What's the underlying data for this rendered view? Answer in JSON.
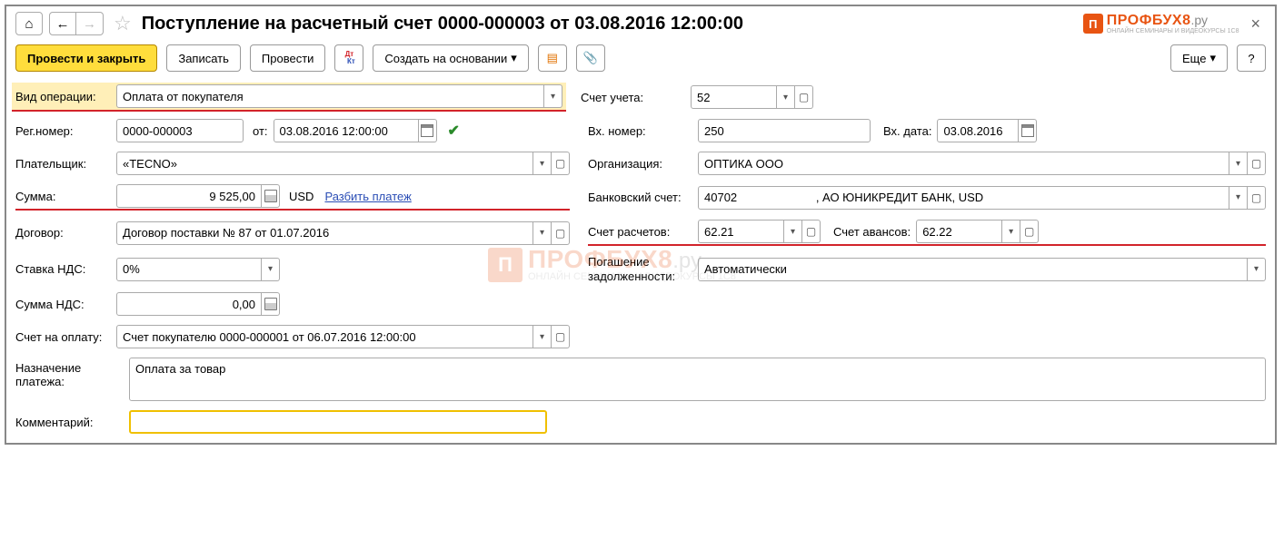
{
  "title": "Поступление на расчетный счет 0000-000003 от 03.08.2016 12:00:00",
  "toolbar": {
    "post_close": "Провести и закрыть",
    "save": "Записать",
    "post": "Провести",
    "create_based": "Создать на основании",
    "more": "Еще",
    "help": "?"
  },
  "logo": {
    "main": "ПРОФБУХ8",
    "ru": ".ру",
    "sub": "ОНЛАЙН СЕМИНАРЫ И ВИДЕОКУРСЫ 1С8"
  },
  "labels": {
    "operation_type": "Вид операции:",
    "account": "Счет учета:",
    "reg_no": "Рег.номер:",
    "from": "от:",
    "in_no": "Вх. номер:",
    "in_date": "Вх. дата:",
    "payer": "Плательщик:",
    "org": "Организация:",
    "sum": "Сумма:",
    "currency": "USD",
    "split": "Разбить платеж",
    "bank_acc": "Банковский счет:",
    "contract": "Договор:",
    "settle_acc": "Счет расчетов:",
    "advance_acc": "Счет авансов:",
    "vat_rate": "Ставка НДС:",
    "debt": "Погашение задолженности:",
    "vat_sum": "Сумма НДС:",
    "invoice": "Счет на оплату:",
    "purpose": "Назначение платежа:",
    "comment": "Комментарий:"
  },
  "values": {
    "operation_type": "Оплата от покупателя",
    "account": "52",
    "reg_no": "0000-000003",
    "reg_date": "03.08.2016 12:00:00",
    "in_no": "250",
    "in_date": "03.08.2016",
    "payer": "«TECNO»",
    "org": "ОПТИКА ООО",
    "sum": "9 525,00",
    "bank_acc": "40702                        , АО ЮНИКРЕДИТ БАНК, USD",
    "contract": "Договор поставки № 87 от 01.07.2016",
    "settle_acc": "62.21",
    "advance_acc": "62.22",
    "vat_rate": "0%",
    "debt": "Автоматически",
    "vat_sum": "0,00",
    "invoice": "Счет покупателю 0000-000001 от 06.07.2016 12:00:00",
    "purpose": "Оплата за товар",
    "comment": ""
  }
}
